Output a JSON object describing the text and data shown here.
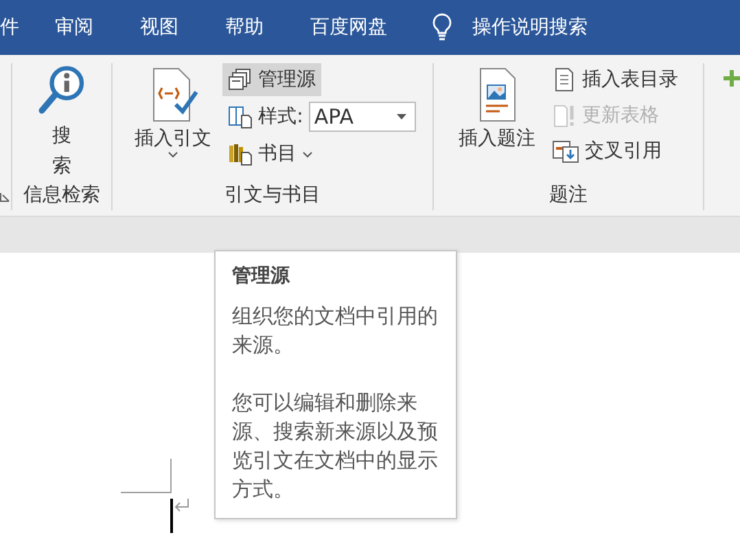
{
  "tabs": [
    {
      "label": "件"
    },
    {
      "label": "审阅"
    },
    {
      "label": "视图"
    },
    {
      "label": "帮助"
    },
    {
      "label": "百度网盘"
    }
  ],
  "tell_me": {
    "placeholder": "操作说明搜索"
  },
  "groups": [
    {
      "label": "信息检索",
      "items": [
        {
          "kind": "large",
          "label": "搜索",
          "dropdown": false
        }
      ]
    },
    {
      "label": "引文与书目",
      "items": [
        {
          "kind": "large",
          "label": "插入引文",
          "dropdown": true
        },
        {
          "kind": "stack",
          "items": [
            {
              "kind": "small",
              "label": "管理源",
              "highlighted": true,
              "disabled": false,
              "dropdown": false
            },
            {
              "kind": "combo",
              "label": "样式:",
              "value": "APA"
            },
            {
              "kind": "small",
              "label": "书目",
              "highlighted": false,
              "disabled": false,
              "dropdown": true
            }
          ]
        }
      ]
    },
    {
      "label": "题注",
      "items": [
        {
          "kind": "large",
          "label": "插入题注",
          "dropdown": false
        },
        {
          "kind": "stack",
          "items": [
            {
              "kind": "small",
              "label": "插入表目录",
              "highlighted": false,
              "disabled": false,
              "dropdown": false
            },
            {
              "kind": "small",
              "label": "更新表格",
              "highlighted": false,
              "disabled": true,
              "dropdown": false
            },
            {
              "kind": "small",
              "label": "交叉引用",
              "highlighted": false,
              "disabled": false,
              "dropdown": false
            }
          ]
        }
      ]
    }
  ],
  "tooltip": {
    "title": "管理源",
    "paragraphs": [
      "组织您的文档中引用的来源。",
      "您可以编辑和删除来源、搜索新来源以及预览引文在文档中的显示方式。"
    ]
  }
}
